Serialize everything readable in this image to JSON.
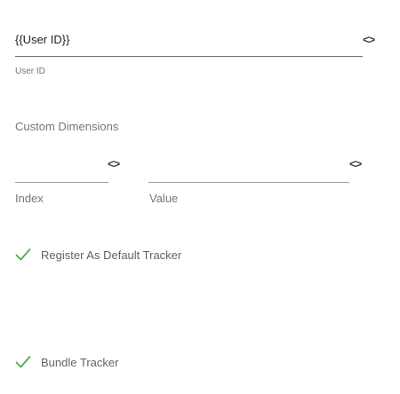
{
  "user_id": {
    "value": "{{User ID}}",
    "label": "User ID",
    "variable_toggle": "<>"
  },
  "custom_dimensions": {
    "title": "Custom Dimensions",
    "index_label": "Index",
    "value_label": "Value",
    "index_value": "",
    "value_value": "",
    "variable_toggle": "<>"
  },
  "options": {
    "register_default": {
      "label": "Register As Default Tracker",
      "checked": true
    },
    "bundle_tracker": {
      "label": "Bundle Tracker",
      "checked": true
    }
  },
  "colors": {
    "check_green": "#4caf50",
    "underline": "#9e9e9e",
    "label_gray": "#757575"
  },
  "icons": {
    "variable": "code-brackets-icon",
    "check": "checkmark-icon"
  }
}
